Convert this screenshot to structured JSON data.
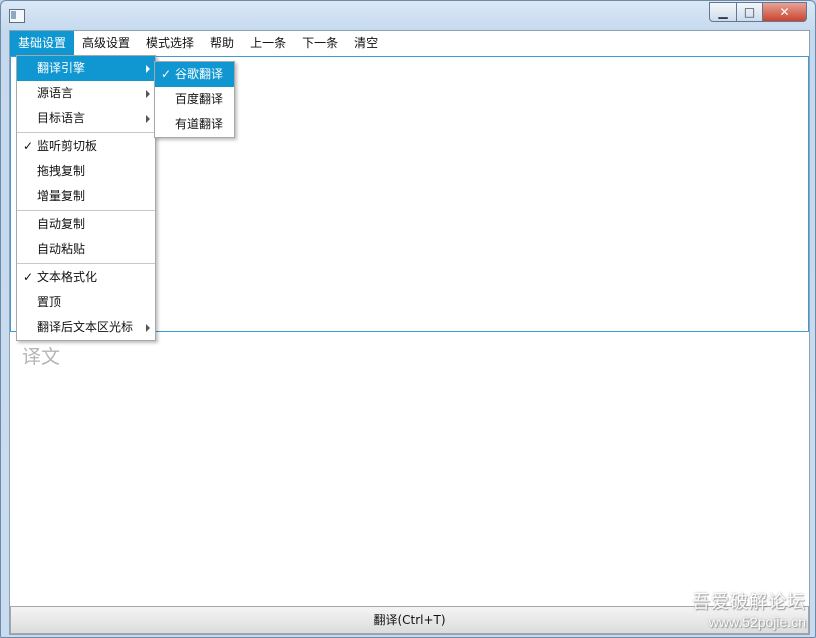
{
  "window": {
    "app_icon": "app-window-icon",
    "min_glyph": "▁",
    "max_glyph": "□",
    "close_glyph": "✕"
  },
  "menubar": {
    "items": [
      {
        "label": "基础设置",
        "active": true
      },
      {
        "label": "高级设置"
      },
      {
        "label": "模式选择"
      },
      {
        "label": "帮助"
      },
      {
        "label": "上一条"
      },
      {
        "label": "下一条"
      },
      {
        "label": "清空"
      }
    ]
  },
  "dropdown": {
    "translation_engine": {
      "label": "翻译引擎",
      "has_submenu": true
    },
    "source_language": {
      "label": "源语言",
      "has_submenu": true
    },
    "target_language": {
      "label": "目标语言",
      "has_submenu": true
    },
    "monitor_clipboard": {
      "label": "监听剪切板",
      "checked": true
    },
    "drag_copy": {
      "label": "拖拽复制"
    },
    "incremental_copy": {
      "label": "增量复制"
    },
    "auto_copy": {
      "label": "自动复制"
    },
    "auto_paste": {
      "label": "自动粘贴"
    },
    "text_format": {
      "label": "文本格式化",
      "checked": true
    },
    "pin_top": {
      "label": "置顶"
    },
    "cursor_after": {
      "label": "翻译后文本区光标",
      "has_submenu": true
    },
    "check_glyph": "✓"
  },
  "submenu": {
    "google": {
      "label": "谷歌翻译",
      "checked": true
    },
    "baidu": {
      "label": "百度翻译"
    },
    "youdao": {
      "label": "有道翻译"
    }
  },
  "main": {
    "source_text": "",
    "target_placeholder": "译文",
    "translate_button": "翻译(Ctrl+T)"
  },
  "watermark": {
    "text": "吾爱破解论坛",
    "url": "www.52pojie.cn"
  },
  "colors": {
    "accent": "#1097d2",
    "source_border": "#3f9bd3",
    "window_frame": "#c5d9ee",
    "close_button": "#c9442e"
  }
}
